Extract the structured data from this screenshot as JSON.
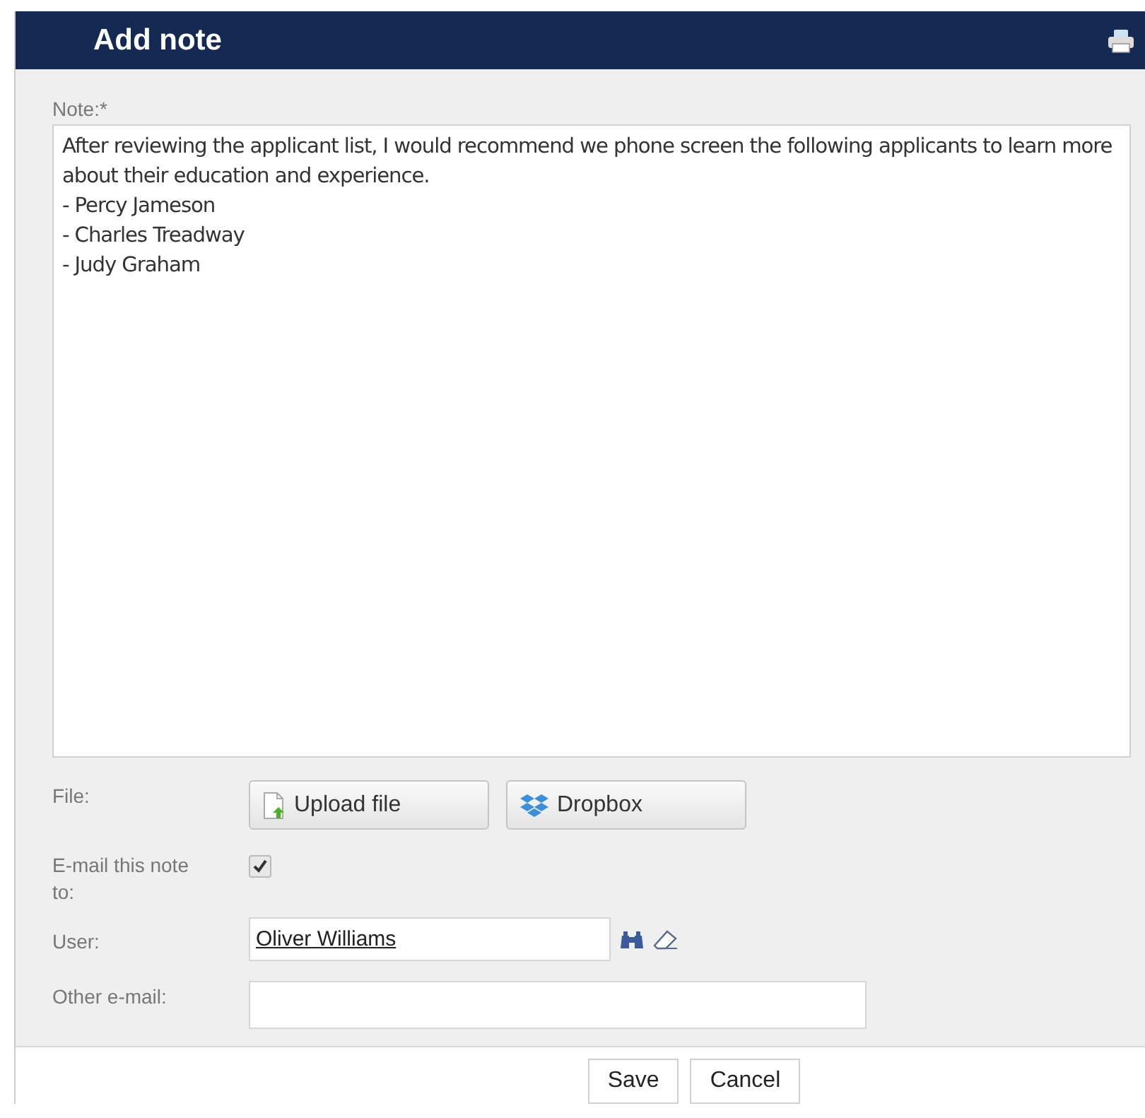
{
  "dialog": {
    "title": "Add note"
  },
  "note": {
    "label": "Note:*",
    "value": "After reviewing the applicant list, I would recommend we phone screen the following applicants to learn more about their education and experience.\n- Percy Jameson\n- Charles Treadway\n- Judy Graham"
  },
  "file": {
    "label": "File:",
    "buttons": [
      {
        "kind": "upload",
        "label": "Upload file"
      },
      {
        "kind": "dropbox",
        "label": "Dropbox"
      }
    ]
  },
  "email_note": {
    "label": "E-mail this note to:",
    "checked": true
  },
  "user": {
    "label": "User:",
    "value": "Oliver Williams"
  },
  "other_email": {
    "label": "Other e-mail:"
  },
  "buttons": [
    "Save",
    "Cancel"
  ]
}
